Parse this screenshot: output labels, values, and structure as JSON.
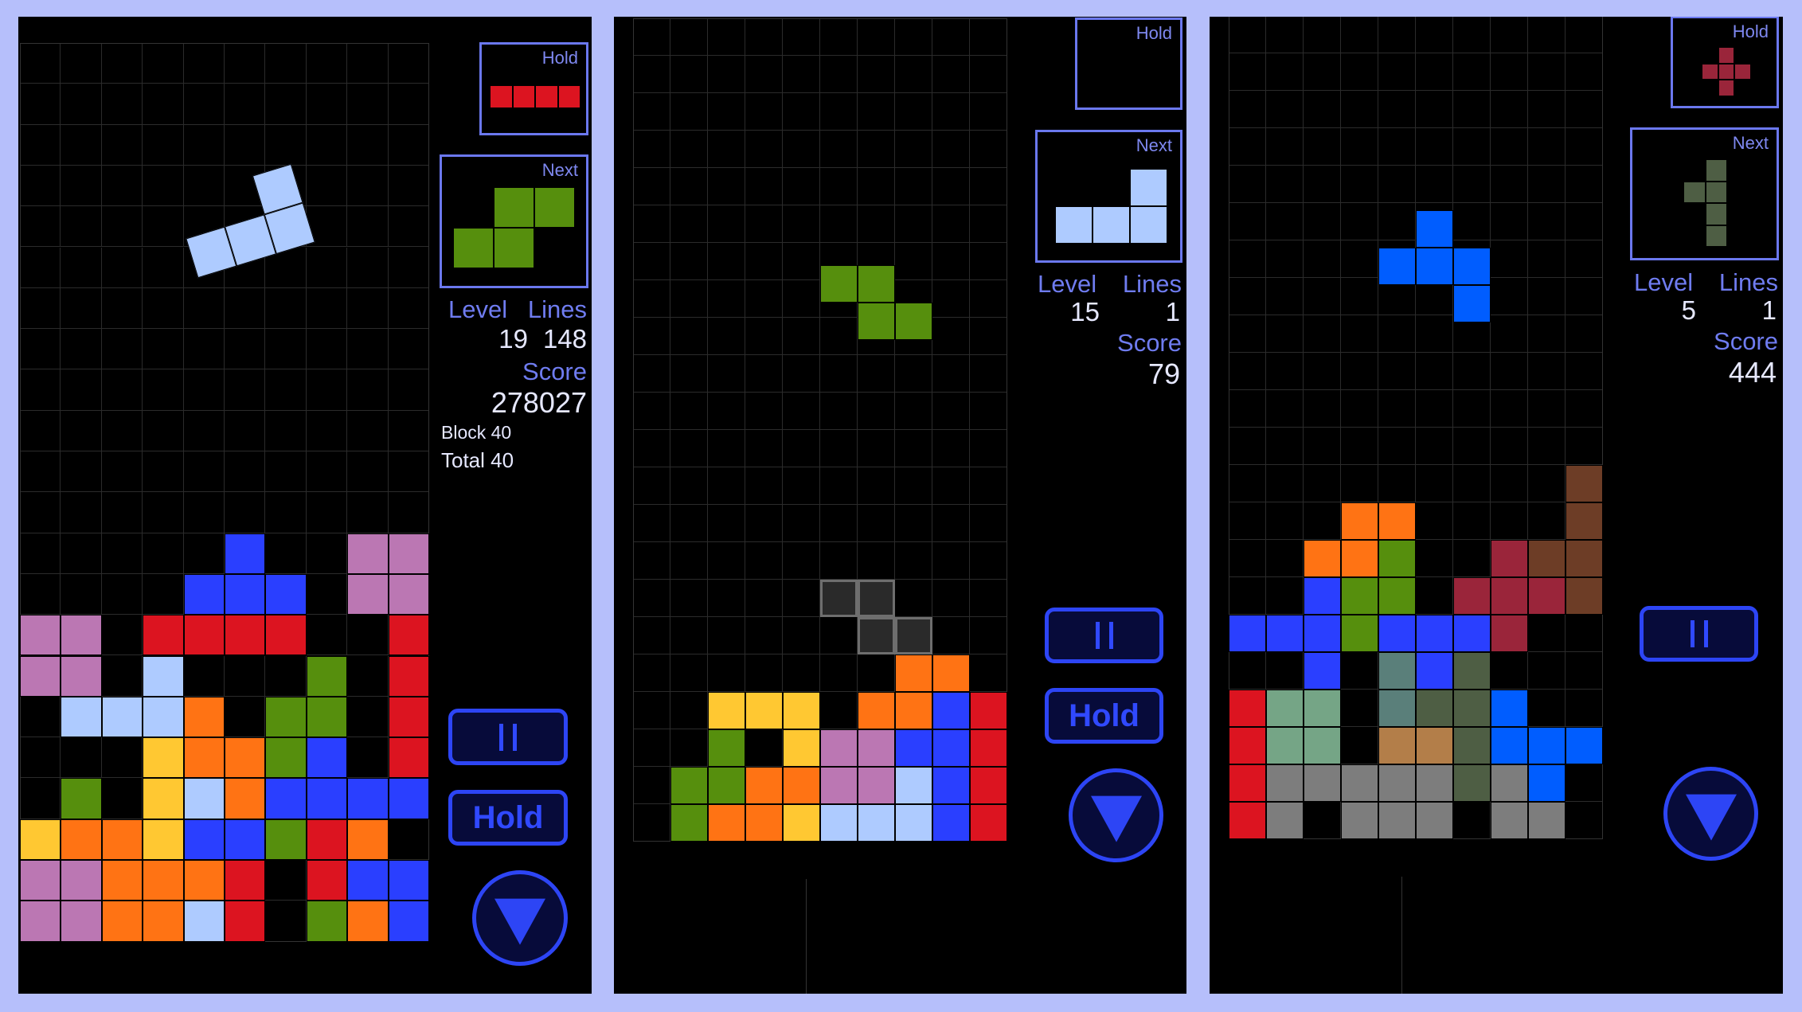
{
  "palette": {
    "P": "#bb77b3",
    "B": "#2a3fff",
    "R": "#dc1420",
    "L": "#aecbff",
    "G": "#568f0d",
    "O": "#ff7314",
    "Y": "#ffc832",
    "T": "#5a7f7a",
    "D": "#4e5e44",
    "S": "#75a586",
    "N": "#b37e49",
    "C": "#005dff",
    "A": "#7d7d7d",
    "M": "#9a253a",
    "W": "#6d3d26"
  },
  "labels": {
    "hold": "Hold",
    "next": "Next",
    "level": "Level",
    "lines": "Lines",
    "score": "Score",
    "hold_button": "Hold"
  },
  "screens": [
    {
      "level": "19",
      "lines": "148",
      "score": "278027",
      "block_text": "Block 40",
      "total_text": "Total 40",
      "has_hold_button": true,
      "hold_piece": {
        "color": "R",
        "shape": [
          "XXXX"
        ]
      },
      "next_piece": {
        "color": "G",
        "shape": [
          ".XX",
          "XX."
        ]
      },
      "active_piece": {
        "color": "L",
        "shape": [
          "..X",
          "XXX"
        ],
        "rotation_deg": -17
      },
      "ghost_piece": null,
      "board": [
        "..........",
        "..........",
        "..........",
        "..........",
        "..........",
        "..........",
        "..........",
        "..........",
        "..........",
        "..........",
        "..........",
        "..........",
        ".....B..PP",
        "....BBB.PP",
        "PP.RRRR..R",
        "PP.L...G.R",
        ".LLLO.GG.R",
        "...YOOGB.R",
        ".G.YLOBBBB",
        "YOOYBBGRO.",
        "PPOOOR.RBB",
        "PPOOLR.GOB"
      ]
    },
    {
      "level": "15",
      "lines": "1",
      "score": "79",
      "has_hold_button": true,
      "hold_piece": null,
      "next_piece": {
        "color": "L",
        "shape": [
          "..X",
          "XXX"
        ]
      },
      "active_piece": {
        "color": "G",
        "shape": [
          "XX.",
          ".XX"
        ],
        "col": 5,
        "row": 6.6
      },
      "ghost_piece": {
        "shape": [
          "XX.",
          ".XX"
        ],
        "col": 5,
        "row": 15
      },
      "board": [
        "..........",
        "..........",
        "..........",
        "..........",
        "..........",
        "..........",
        "..........",
        "..........",
        "..........",
        "..........",
        "..........",
        "..........",
        "..........",
        "..........",
        "..........",
        "..........",
        "..........",
        ".......OO.",
        "..YYY.OOBR",
        "..G.YPPBBR",
        ".GGOOPPLBR",
        ".GOOYLLLBR"
      ]
    },
    {
      "level": "5",
      "lines": "1",
      "score": "444",
      "has_hold_button": false,
      "hold_piece": {
        "color": "M",
        "shape": [
          ".X.",
          "XXX",
          ".X."
        ]
      },
      "next_piece": {
        "color": "D",
        "shape": [
          ".X",
          "XX",
          ".X",
          ".X"
        ]
      },
      "active_piece": {
        "color": "C",
        "shape": [
          ".X.",
          "XXX",
          "..X"
        ],
        "col": 4,
        "row": 5.2
      },
      "ghost_piece": null,
      "board": [
        "..........",
        "..........",
        "..........",
        "..........",
        "..........",
        "..........",
        "..........",
        "..........",
        "..........",
        "..........",
        "..........",
        "..........",
        ".........W",
        "...OO....W",
        "..OOG..MWW",
        "..BGG.MMMW",
        "BBBGBBBM..",
        "..B.TBD...",
        "RSS.TDDC..",
        "RSS.NNDCCC",
        "RAAAAADAC.",
        "RA.AAA.AA."
      ]
    }
  ]
}
